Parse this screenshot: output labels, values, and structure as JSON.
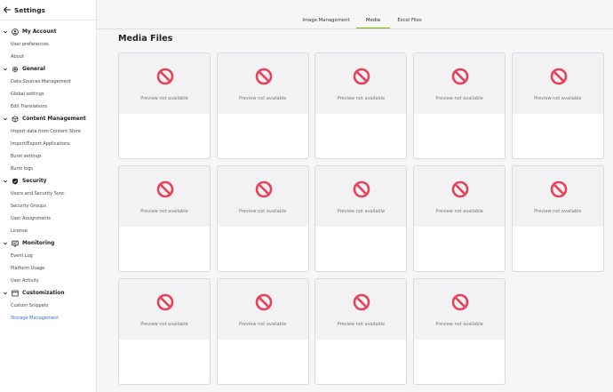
{
  "header": {
    "title": "Settings"
  },
  "sidebar": {
    "sections": [
      {
        "label": "My Account",
        "icon": "user-icon",
        "items": [
          "User preferences",
          "About"
        ]
      },
      {
        "label": "General",
        "icon": "gear-icon",
        "items": [
          "Data Sources Management",
          "Global settings",
          "Edit Translations"
        ]
      },
      {
        "label": "Content Management",
        "icon": "cube-icon",
        "items": [
          "Import data from Content Store",
          "Import/Export Applications",
          "Burst settings",
          "Burst logs"
        ]
      },
      {
        "label": "Security",
        "icon": "shield-icon",
        "items": [
          "Users and Security Sync",
          "Security Groups",
          "User Assignments",
          "License"
        ]
      },
      {
        "label": "Monitoring",
        "icon": "monitor-icon",
        "items": [
          "Event Log",
          "Platform Usage",
          "User Activity"
        ]
      },
      {
        "label": "Customization",
        "icon": "window-icon",
        "items": [
          "Custom Snippets",
          "Storage Management"
        ]
      }
    ],
    "active_item": "Storage Management"
  },
  "tabs": [
    "Image Management",
    "Media",
    "Excel Files"
  ],
  "active_tab": "Media",
  "page": {
    "title": "Media Files"
  },
  "cards": [
    {
      "text": "Preview not available"
    },
    {
      "text": "Preview not available"
    },
    {
      "text": "Preview not available"
    },
    {
      "text": "Preview not available"
    },
    {
      "text": "Preview not available"
    },
    {
      "text": "Preview not available"
    },
    {
      "text": "Preview not available"
    },
    {
      "text": "Preview not available"
    },
    {
      "text": "Preview not available"
    },
    {
      "text": "Preview not available"
    },
    {
      "text": "Preview not available"
    },
    {
      "text": "Preview not available"
    },
    {
      "text": "Preview not available"
    },
    {
      "text": "Preview not available"
    }
  ],
  "colors": {
    "accent": "#76b900",
    "link": "#2f72d9",
    "no_preview_icon": "#e8425a"
  }
}
